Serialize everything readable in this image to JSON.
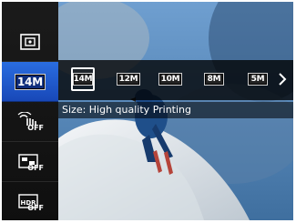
{
  "sidebar": {
    "items": [
      {
        "label": ""
      },
      {
        "label": "14M"
      },
      {
        "label": "OFF"
      },
      {
        "label": "OFF"
      },
      {
        "label": "OFF"
      }
    ]
  },
  "size_options": [
    {
      "label": "14M",
      "selected": true
    },
    {
      "label": "12M",
      "selected": false
    },
    {
      "label": "10M",
      "selected": false
    },
    {
      "label": "8M",
      "selected": false
    },
    {
      "label": "5M",
      "selected": false
    }
  ],
  "caption": "Size: High quality Printing",
  "colors": {
    "accent": "#2a6de0",
    "bar": "#000000"
  },
  "icons": {
    "sidebar": [
      "metering-icon",
      "image-size-icon",
      "stabilizer-off-icon",
      "scene-effect-off-icon",
      "hdr-off-icon"
    ],
    "next": "chevron-right-icon"
  }
}
